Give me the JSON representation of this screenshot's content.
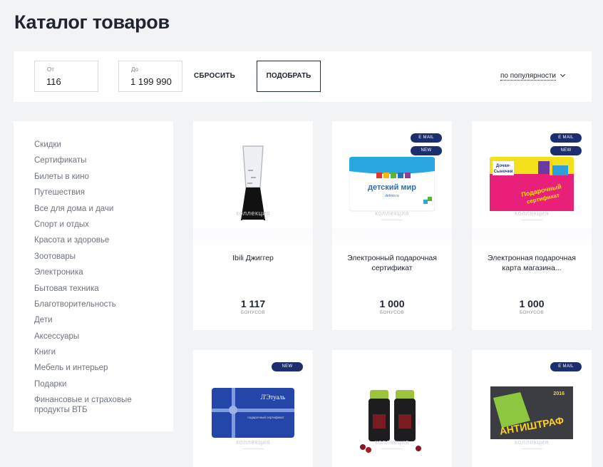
{
  "title": "Каталог товаров",
  "filter": {
    "from_label": "От",
    "from_value": "116",
    "to_label": "До",
    "to_value": "1 199 990",
    "reset_label": "СБРОСИТЬ",
    "apply_label": "ПОДОБРАТЬ",
    "sort_label": "по популярности"
  },
  "sidebar": {
    "items": [
      "Скидки",
      "Сертификаты",
      "Билеты в кино",
      "Путешествия",
      "Все для дома и дачи",
      "Спорт и отдых",
      "Красота и здоровье",
      "Зоотовары",
      "Электроника",
      "Бытовая техника",
      "Благотворительность",
      "Дети",
      "Аксессуары",
      "Книги",
      "Мебель и интерьер",
      "Подарки",
      "Финансовые и страховые продукты ВТБ"
    ]
  },
  "watermark": "коллекция",
  "products": [
    {
      "name": "Ibili Джиггер",
      "price": "1 117",
      "unit": "БОНУСОВ",
      "badges": []
    },
    {
      "name": "Электронный подарочная сертификат",
      "price": "1 000",
      "unit": "БОНУСОВ",
      "badges": [
        "E MAIL",
        "NEW"
      ],
      "brand": "детский мир",
      "brand_sub": "detmir.ru"
    },
    {
      "name": "Электронная подарочная карта магазина...",
      "price": "1 000",
      "unit": "БОНУСОВ",
      "badges": [
        "E MAIL",
        "NEW"
      ],
      "brand": "Дочки- Сыночки",
      "banner": "Подарочный сертификат"
    },
    {
      "badges": [
        "NEW"
      ],
      "brand": "Л'Этуаль",
      "card_text": "подарочный сертификат"
    },
    {
      "badges": []
    },
    {
      "badges": [
        "E MAIL"
      ],
      "brand": "АНТИШТРАФ",
      "year": "2016"
    }
  ]
}
